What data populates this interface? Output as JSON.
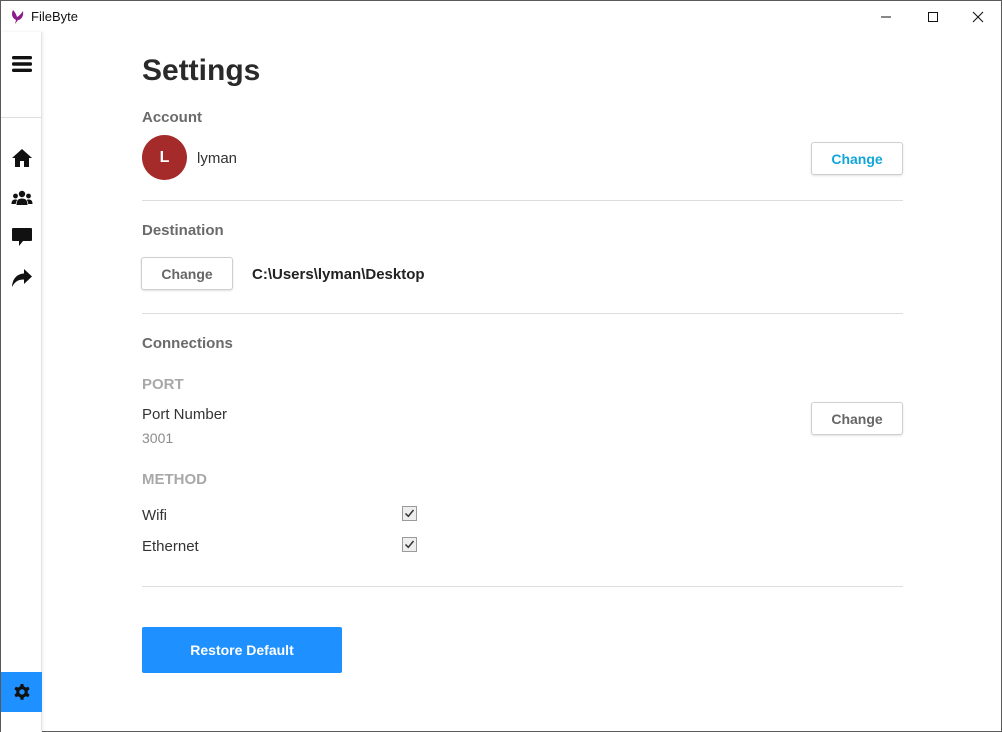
{
  "window": {
    "title": "FileByte",
    "logo_color": "#8b1a8b"
  },
  "sidebar": {
    "items": [
      {
        "icon": "menu-icon"
      },
      {
        "icon": "home-icon"
      },
      {
        "icon": "users-icon"
      },
      {
        "icon": "chat-icon"
      },
      {
        "icon": "share-icon"
      }
    ],
    "active": {
      "icon": "gear-icon",
      "color": "#1e90ff"
    }
  },
  "settings": {
    "title": "Settings",
    "account": {
      "heading": "Account",
      "avatar_letter": "L",
      "avatar_color": "#a52a2a",
      "username": "lyman",
      "change_label": "Change"
    },
    "destination": {
      "heading": "Destination",
      "change_label": "Change",
      "path": "C:\\Users\\lyman\\Desktop"
    },
    "connections": {
      "heading": "Connections",
      "port": {
        "heading": "PORT",
        "label": "Port Number",
        "value": "3001",
        "change_label": "Change"
      },
      "method": {
        "heading": "METHOD",
        "options": [
          {
            "label": "Wifi",
            "checked": true
          },
          {
            "label": "Ethernet",
            "checked": true
          }
        ]
      }
    },
    "restore_label": "Restore Default",
    "accent_color": "#1e90ff"
  }
}
